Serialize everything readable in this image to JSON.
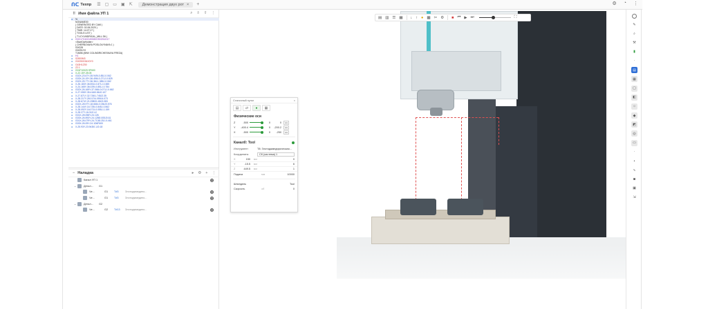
{
  "app": {
    "name": "Техпр",
    "tab_title": "Демонстрация двух рот",
    "tab_close": "×",
    "tab_add": "+"
  },
  "file_panel": {
    "title": "Имя файла УП 1",
    "lines": [
      {
        "text": "%",
        "color": "black",
        "mark": "●"
      },
      {
        "text": "NONAME00",
        "color": "black",
        "mark": ""
      },
      {
        "text": "",
        "color": "black",
        "mark": ""
      },
      {
        "text": "( GENERATED BY CAM )",
        "color": "black",
        "mark": ""
      },
      {
        "text": "( DATE: 02.06.2020 )",
        "color": "black",
        "mark": ""
      },
      {
        "text": "( TIME: 14:27:17 )",
        "color": "black",
        "mark": ""
      },
      {
        "text": "",
        "color": "black",
        "mark": ""
      },
      {
        "text": "( TOOLS LIST )",
        "color": "black",
        "mark": ""
      },
      {
        "text": "( T1:CYLINDRICAL_MILL D6 )",
        "color": "black",
        "mark": ""
      },
      {
        "text": "",
        "color": "black",
        "mark": ""
      },
      {
        "text": "G0G17G40G49G80G90G94G17",
        "color": "purple",
        "mark": "●"
      },
      {
        "text": "<StartOpHolder>",
        "color": "black",
        "mark": ""
      },
      {
        "text": "( CHERNOVAYA POSLOUYNAYA 1 )",
        "color": "black",
        "mark": ""
      },
      {
        "text": "G0G28",
        "color": "black",
        "mark": ""
      },
      {
        "text": "G0G91Y0",
        "color": "black",
        "mark": ""
      },
      {
        "text": "T1M06 (MNV COLINDRICHESKAYA FREZA)",
        "color": "black",
        "mark": ""
      },
      {
        "text": "H1",
        "color": "purple",
        "mark": "●"
      },
      {
        "text": "S2800M3",
        "color": "red",
        "mark": "●"
      },
      {
        "text": "G0G90G54X0Y0",
        "color": "red",
        "mark": "●"
      },
      {
        "text": "G43H1Z50",
        "color": "red",
        "mark": "●"
      },
      {
        "text": "Z2.1",
        "color": "red",
        "mark": "●"
      },
      {
        "text": "G01F100Z0.9F600",
        "color": "green",
        "mark": "●"
      },
      {
        "text": "X-22.15Y-35.05",
        "color": "green",
        "mark": "●"
      },
      {
        "text": "G02X-23.67Y-35.949I-0.85J-0.062",
        "color": "blue",
        "mark": "●"
      },
      {
        "text": "G03X-24.19Y-36.496I-0.271J-0.825",
        "color": "blue",
        "mark": "●"
      },
      {
        "text": "G02X-25.77Y-36.36I-1.385J-0.062",
        "color": "blue",
        "mark": "●"
      },
      {
        "text": "X-26.183Y-36.551I-0.871J-0.385",
        "color": "blue",
        "mark": "●"
      },
      {
        "text": "X-24.165Y-36.029I-0.851J-0.784",
        "color": "blue",
        "mark": "●"
      },
      {
        "text": "G02X-26.169Y-37.066I-0.071J-0.662",
        "color": "blue",
        "mark": "●"
      },
      {
        "text": "X-27.055Y-35.416I0.86J0.107",
        "color": "blue",
        "mark": "●"
      },
      {
        "text": "X-27.871Y-32.726I1.745J2.35",
        "color": "blue",
        "mark": "●"
      },
      {
        "text": "X-28.217Y-28.017I4.059J4.073",
        "color": "blue",
        "mark": "●"
      },
      {
        "text": "X-28.674Y-21.098I31.65J3.083",
        "color": "blue",
        "mark": "●"
      },
      {
        "text": "G02X-28.97Y-18.666I-0.036J0.576",
        "color": "blue",
        "mark": "●"
      },
      {
        "text": "X-28.144Y-16.725I-0.845J-0.562",
        "color": "blue",
        "mark": "●"
      },
      {
        "text": "X-28.092Y-16.071I-0.055J-1.159",
        "color": "blue",
        "mark": "●"
      },
      {
        "text": "X-28.27Y-16.01I2.4J",
        "color": "blue",
        "mark": "●"
      },
      {
        "text": "G01X-28.058Y-24.126",
        "color": "blue",
        "mark": "●"
      },
      {
        "text": "G03X-26.593Y-24.128I0.005J0.61",
        "color": "blue",
        "mark": "●"
      },
      {
        "text": "G01X-26.079Y-24.713I0.25J-0.461",
        "color": "blue",
        "mark": "●"
      },
      {
        "text": "G03X-26.05Y-24.1D6F600",
        "color": "blue",
        "mark": "●"
      },
      {
        "text": "X-25.93Y-23.943I0.1J0.18",
        "color": "blue",
        "mark": "●"
      }
    ]
  },
  "setup_panel": {
    "title": "Наладка",
    "rows": [
      {
        "indent": 0,
        "arrow": "",
        "c1": "Канал УП 1",
        "c2": "",
        "c3": "",
        "c4": "",
        "radio": true
      },
      {
        "indent": 0,
        "arrow": "⌄",
        "c1": "Детал...",
        "c2": "G1",
        "c3": "",
        "c4": "",
        "radio": false
      },
      {
        "indent": 1,
        "arrow": "",
        "c1": "Че...",
        "c2": "G1",
        "c3": "Т#3",
        "c4": "Злотоджмедино...",
        "radio": true
      },
      {
        "indent": 1,
        "arrow": "",
        "c1": "Че...",
        "c2": "G1",
        "c3": "Т#3",
        "c4": "Злотоджмедино...",
        "radio": true
      },
      {
        "indent": 0,
        "arrow": "⌄",
        "c1": "Детал...",
        "c2": "G2",
        "c3": "",
        "c4": "",
        "radio": false
      },
      {
        "indent": 1,
        "arrow": "",
        "c1": "Че...",
        "c2": "G2",
        "c3": "Т#13",
        "c4": "Злотоджмедино...",
        "radio": true
      }
    ]
  },
  "control_panel": {
    "title": "Станочный пульт",
    "close": "×",
    "axes_title": "Физические оси",
    "axes": [
      {
        "name": "Z",
        "value": "-500",
        "value2": "0",
        "value3": "0",
        "unit": "мм"
      },
      {
        "name": "Y",
        "value": "-400.4",
        "value2": "0",
        "value3": "-200.2",
        "unit": "мм"
      },
      {
        "name": "X",
        "value": "-500",
        "value2": "0",
        "value3": "-250",
        "unit": "мм"
      }
    ],
    "channel_title": "Канал0: Tool",
    "tool_label": "Инструмент",
    "tool_value": "Т8: Злотоджмедирическая...",
    "coord_label": "Координаты",
    "coord_value": "СК (система) 1",
    "coords": [
      {
        "axis": "X",
        "v1": "150",
        "u1": "мм",
        "v2": "0"
      },
      {
        "axis": "Y",
        "v1": "-15.5",
        "u1": "мм",
        "v2": "6"
      },
      {
        "axis": "Z",
        "v1": "449.5",
        "u1": "мм",
        "v2": "1"
      }
    ],
    "feed_label": "Подача",
    "feed_unit": "мм",
    "feed_value": "10000",
    "spindle_label": "Шпиндель",
    "spindle_value": "Tool",
    "speed_label": "Скорость",
    "speed_unit": "об",
    "speed_value": "0"
  },
  "view_toolbar": {
    "speed_fraction": 0.45
  }
}
